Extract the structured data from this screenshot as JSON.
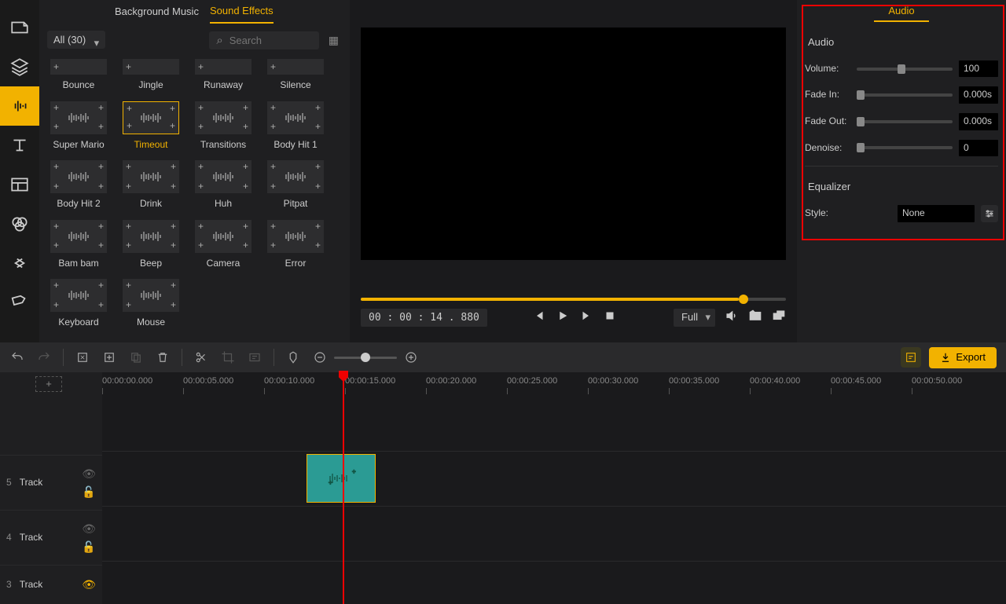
{
  "sidebar": {
    "items": [
      "media",
      "layers",
      "audio",
      "text",
      "templates",
      "filters",
      "transitions",
      "elements"
    ]
  },
  "tabs": {
    "bgmusic": "Background Music",
    "sfx": "Sound Effects"
  },
  "filter": {
    "all": "All (30)",
    "search_placeholder": "Search"
  },
  "fx": [
    {
      "label": "Bounce"
    },
    {
      "label": "Jingle"
    },
    {
      "label": "Runaway"
    },
    {
      "label": "Silence"
    },
    {
      "label": "Super Mario"
    },
    {
      "label": "Timeout",
      "sel": true
    },
    {
      "label": "Transitions"
    },
    {
      "label": "Body Hit 1"
    },
    {
      "label": "Body Hit 2"
    },
    {
      "label": "Drink"
    },
    {
      "label": "Huh"
    },
    {
      "label": "Pitpat"
    },
    {
      "label": "Bam bam"
    },
    {
      "label": "Beep"
    },
    {
      "label": "Camera"
    },
    {
      "label": "Error"
    },
    {
      "label": "Keyboard"
    },
    {
      "label": "Mouse"
    }
  ],
  "transport": {
    "timecode": "00 : 00 : 14 . 880",
    "viewmode": "Full"
  },
  "right": {
    "tab": "Audio",
    "audio_title": "Audio",
    "volume_label": "Volume:",
    "volume_value": "100",
    "fadein_label": "Fade In:",
    "fadein_value": "0.000s",
    "fadeout_label": "Fade Out:",
    "fadeout_value": "0.000s",
    "denoise_label": "Denoise:",
    "denoise_value": "0",
    "eq_title": "Equalizer",
    "style_label": "Style:",
    "style_value": "None"
  },
  "toolbar": {
    "export": "Export"
  },
  "timeline": {
    "ticks": [
      "00:00:00.000",
      "00:00:05.000",
      "00:00:10.000",
      "00:00:15.000",
      "00:00:20.000",
      "00:00:25.000",
      "00:00:30.000",
      "00:00:35.000",
      "00:00:40.000",
      "00:00:45.000",
      "00:00:50.000"
    ],
    "tracks": [
      {
        "num": "5",
        "name": "Track"
      },
      {
        "num": "4",
        "name": "Track"
      },
      {
        "num": "3",
        "name": "Track"
      }
    ]
  }
}
